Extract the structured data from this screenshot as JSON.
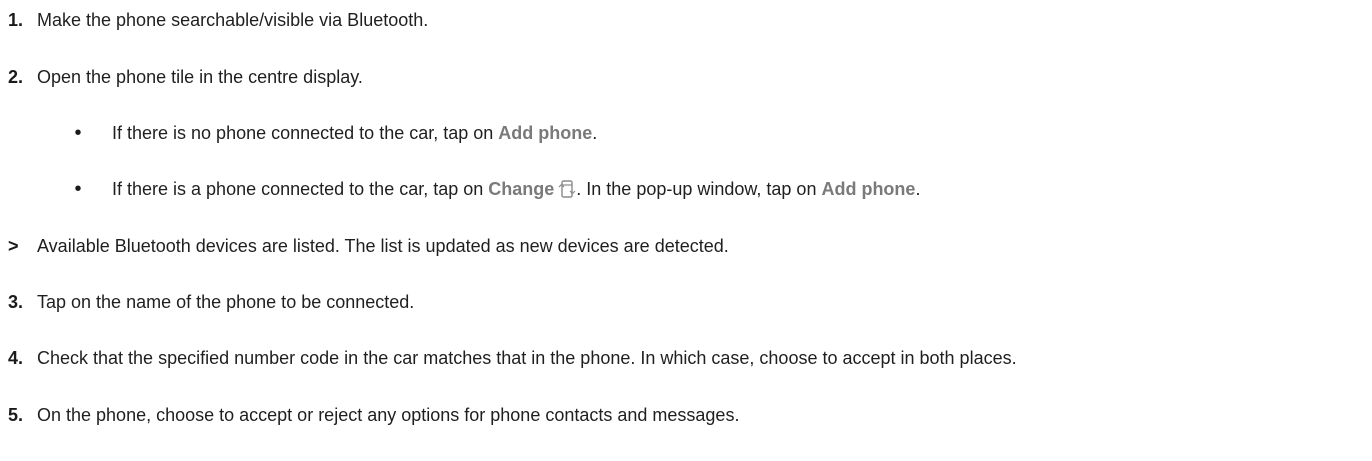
{
  "steps": {
    "s1": {
      "num": "1.",
      "text": "Make the phone searchable/visible via Bluetooth."
    },
    "s2": {
      "num": "2.",
      "text": "Open the phone tile in the centre display."
    },
    "b1": {
      "pre": "If there is no phone connected to the car, tap on ",
      "ui": "Add phone",
      "post": "."
    },
    "b2": {
      "pre": "If there is a phone connected to the car, tap on ",
      "ui1": "Change",
      "mid": ". In the pop-up window, tap on ",
      "ui2": "Add phone",
      "post": "."
    },
    "result": {
      "marker": ">",
      "text": "Available Bluetooth devices are listed. The list is updated as new devices are detected."
    },
    "s3": {
      "num": "3.",
      "text": "Tap on the name of the phone to be connected."
    },
    "s4": {
      "num": "4.",
      "text": "Check that the specified number code in the car matches that in the phone. In which case, choose to accept in both places."
    },
    "s5": {
      "num": "5.",
      "text": "On the phone, choose to accept or reject any options for phone contacts and messages."
    }
  },
  "icons": {
    "change": "phone-switch-icon"
  },
  "colors": {
    "text": "#1f1f1f",
    "ui_label": "#7a7a7a"
  }
}
